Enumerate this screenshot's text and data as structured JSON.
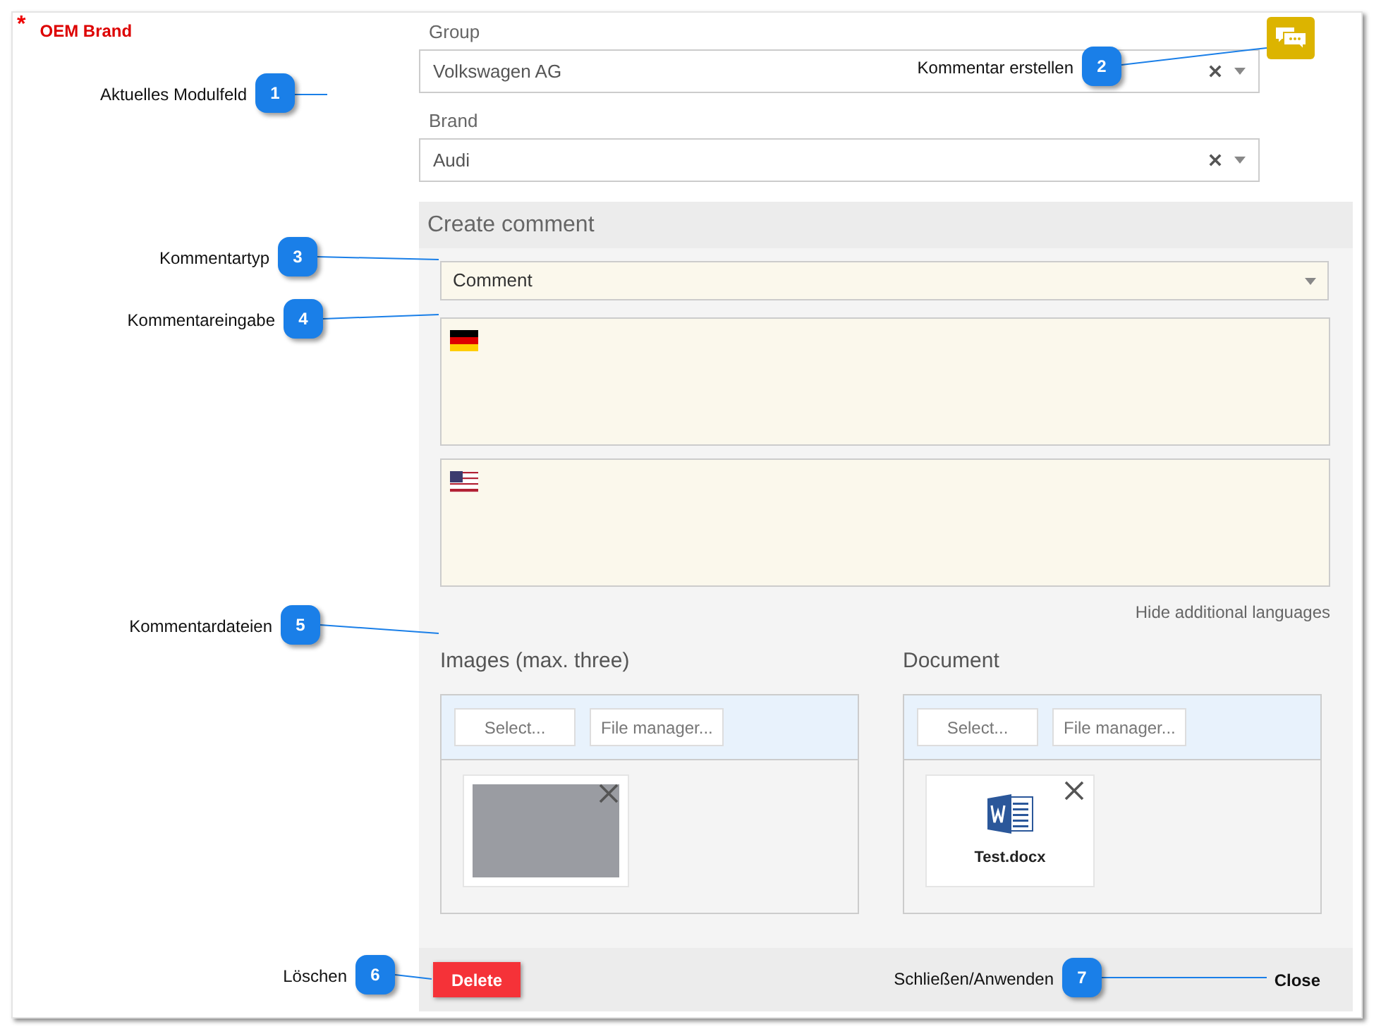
{
  "field": {
    "required_mark": "*",
    "label": "OEM Brand"
  },
  "group": {
    "label": "Group",
    "value": "Volkswagen AG"
  },
  "brand": {
    "label": "Brand",
    "value": "Audi"
  },
  "comment_panel": {
    "title": "Create comment",
    "type_value": "Comment",
    "languages": [
      {
        "kind": "de"
      },
      {
        "kind": "us"
      }
    ],
    "hide_languages_link": "Hide additional languages",
    "images": {
      "title": "Images (max. three)",
      "buttons": [
        "Select...",
        "File manager..."
      ],
      "items": [
        {
          "kind": "photo"
        }
      ]
    },
    "document": {
      "title": "Document",
      "buttons": [
        "Select...",
        "File manager..."
      ],
      "items": [
        {
          "kind": "word",
          "name": "Test.docx"
        }
      ]
    },
    "delete_button": "Delete",
    "close_button": "Close"
  },
  "callouts": [
    {
      "number": "1",
      "label": "Aktuelles Modulfeld"
    },
    {
      "number": "2",
      "label": "Kommentar erstellen"
    },
    {
      "number": "3",
      "label": "Kommentartyp"
    },
    {
      "number": "4",
      "label": "Kommentareingabe"
    },
    {
      "number": "5",
      "label": "Kommentardateien"
    },
    {
      "number": "6",
      "label": "Löschen"
    },
    {
      "number": "7",
      "label": "Schließen/Anwenden"
    }
  ]
}
